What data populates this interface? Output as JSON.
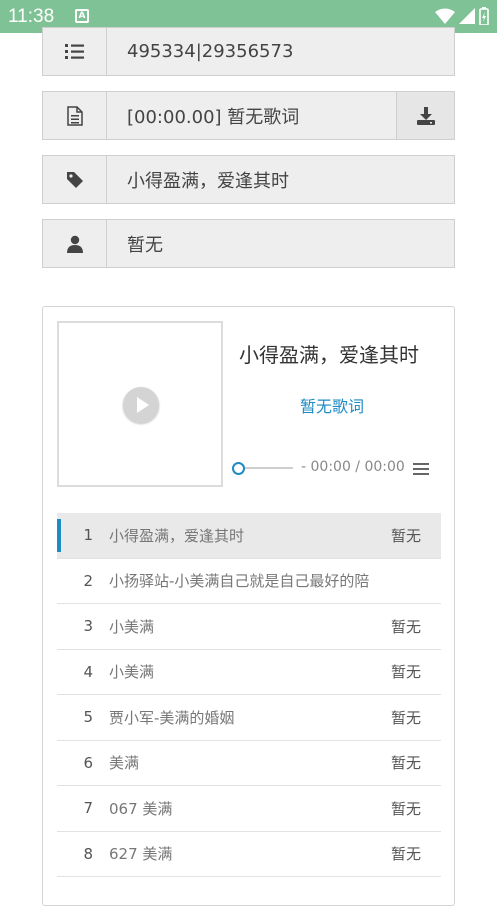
{
  "status": {
    "time": "11:38",
    "notif_letter": "A"
  },
  "fields": {
    "id_value": "495334|29356573",
    "lyric_value": "[00:00.00] 暂无歌词",
    "title_value": "小得盈满，爱逢其时",
    "artist_value": "暂无"
  },
  "player": {
    "title": "小得盈满，爱逢其时",
    "lyric": "暂无歌词",
    "time": "- 00:00 / 00:00"
  },
  "playlist": [
    {
      "num": "1",
      "name": "小得盈满，爱逢其时",
      "artist": "暂无"
    },
    {
      "num": "2",
      "name": "小扬驿站-小美满自己就是自己最好的陪",
      "artist": ""
    },
    {
      "num": "3",
      "name": "小美满",
      "artist": "暂无"
    },
    {
      "num": "4",
      "name": "小美满",
      "artist": "暂无"
    },
    {
      "num": "5",
      "name": "贾小军-美满的婚姻",
      "artist": "暂无"
    },
    {
      "num": "6",
      "name": "美满",
      "artist": "暂无"
    },
    {
      "num": "7",
      "name": "067 美满",
      "artist": "暂无"
    },
    {
      "num": "8",
      "name": "627 美满",
      "artist": "暂无"
    }
  ],
  "colors": {
    "accent": "#1e8bc3",
    "statusbar": "#7fc295"
  }
}
